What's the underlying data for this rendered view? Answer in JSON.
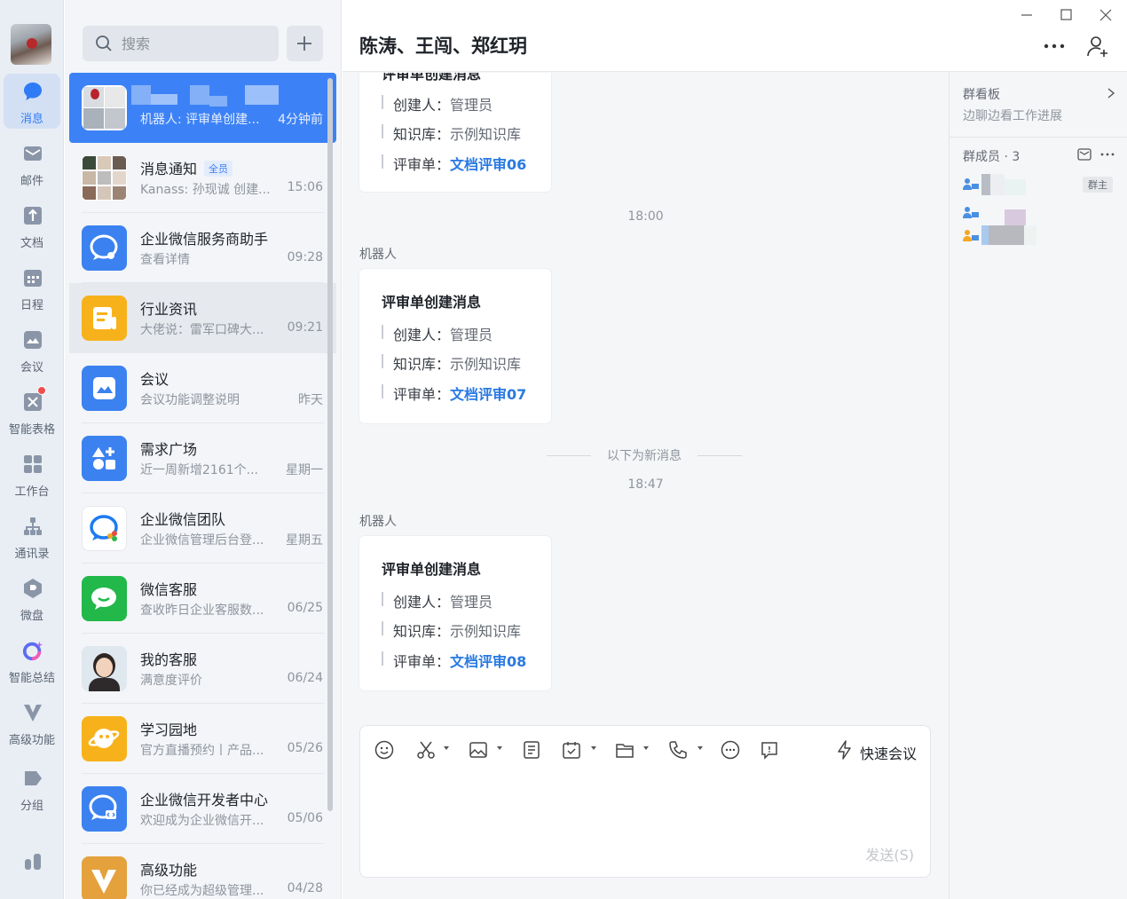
{
  "rail": {
    "items": [
      {
        "label": "消息",
        "icon": "message-bubble-icon",
        "active": true
      },
      {
        "label": "邮件",
        "icon": "mail-icon"
      },
      {
        "label": "文档",
        "icon": "document-icon"
      },
      {
        "label": "日程",
        "icon": "calendar-icon"
      },
      {
        "label": "会议",
        "icon": "meeting-icon"
      },
      {
        "label": "智能表格",
        "icon": "smart-table-icon",
        "badge": true
      },
      {
        "label": "工作台",
        "icon": "workbench-grid-icon"
      },
      {
        "label": "通讯录",
        "icon": "contacts-icon"
      },
      {
        "label": "微盘",
        "icon": "cloud-drive-icon"
      },
      {
        "label": "智能总结",
        "icon": "smart-summary-icon"
      },
      {
        "label": "高级功能",
        "icon": "advanced-features-icon"
      },
      {
        "label": "分组",
        "icon": "group-tag-icon"
      }
    ],
    "bottom_icon": "stats-bars-icon"
  },
  "search": {
    "placeholder": "搜索"
  },
  "conversations": [
    {
      "title": "",
      "preview": "机器人: 评审单创建...",
      "time": "4分钟前",
      "selected": true
    },
    {
      "title": "消息通知",
      "tag": "全员",
      "preview": "Kanass: 孙现诚 创建...",
      "time": "15:06"
    },
    {
      "title": "企业微信服务商助手",
      "preview": "查看详情",
      "time": "09:28"
    },
    {
      "title": "行业资讯",
      "preview": "大佬说：雷军口碑大...",
      "time": "09:21"
    },
    {
      "title": "会议",
      "preview": "会议功能调整说明",
      "time": "昨天"
    },
    {
      "title": "需求广场",
      "preview": "近一周新增2161个...",
      "time": "星期一"
    },
    {
      "title": "企业微信团队",
      "preview": "企业微信管理后台登...",
      "time": "星期五"
    },
    {
      "title": "微信客服",
      "preview": "查收昨日企业客服数...",
      "time": "06/25"
    },
    {
      "title": "我的客服",
      "preview": "满意度评价",
      "time": "06/24"
    },
    {
      "title": "学习园地",
      "preview": "官方直播预约丨产品...",
      "time": "05/26"
    },
    {
      "title": "企业微信开发者中心",
      "preview": "欢迎成为企业微信开...",
      "time": "05/06"
    },
    {
      "title": "高级功能",
      "preview": "你已经成为超级管理...",
      "time": "04/28"
    }
  ],
  "chat": {
    "title": "陈涛、王闯、郑红玥",
    "partial_card": {
      "title": "评审单创建消息",
      "creator_label": "创建人：",
      "creator": "管理员",
      "kb_label": "知识库：",
      "kb": "示例知识库",
      "review_label": "评审单：",
      "review": "文档评审06"
    },
    "time1": "18:00",
    "sender1": "机器人",
    "card1": {
      "title": "评审单创建消息",
      "creator_label": "创建人：",
      "creator": "管理员",
      "kb_label": "知识库：",
      "kb": "示例知识库",
      "review_label": "评审单：",
      "review": "文档评审07"
    },
    "new_messages_divider": "以下为新消息",
    "time2": "18:47",
    "sender2": "机器人",
    "card2": {
      "title": "评审单创建消息",
      "creator_label": "创建人：",
      "creator": "管理员",
      "kb_label": "知识库：",
      "kb": "示例知识库",
      "review_label": "评审单：",
      "review": "文档评审08"
    }
  },
  "composer": {
    "quick_meeting": "快速会议",
    "send": "发送(S)"
  },
  "side": {
    "board_title": "群看板",
    "board_subtitle": "边聊边看工作进展",
    "members_title": "群成员 · 3",
    "owner_tag": "群主"
  },
  "colors": {
    "accent": "#3c82f6",
    "link": "#2a7ae2",
    "badge": "#f24d4d"
  }
}
